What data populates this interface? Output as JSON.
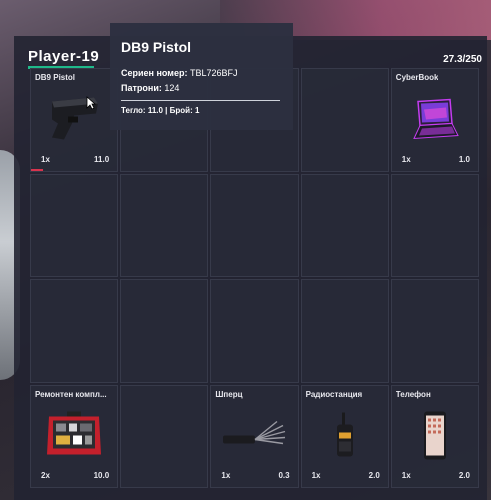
{
  "player": {
    "name": "Player-19",
    "weight": "27.3/250"
  },
  "tooltip": {
    "title": "DB9 Pistol",
    "serial_label": "Сериен номер:",
    "serial_value": "TBL726BFJ",
    "ammo_label": "Патрони:",
    "ammo_value": "124",
    "footer": "Тегло: 11.0 | Брой: 1"
  },
  "slots": [
    {
      "name": "DB9 Pistol",
      "qty": "1x",
      "weight": "11.0",
      "icon": "pistol-icon"
    },
    {
      "name": "",
      "qty": "",
      "weight": ""
    },
    {
      "name": "",
      "qty": "",
      "weight": ""
    },
    {
      "name": "",
      "qty": "",
      "weight": ""
    },
    {
      "name": "CyberBook",
      "qty": "1x",
      "weight": "1.0",
      "icon": "laptop-icon"
    },
    {
      "name": "",
      "qty": "",
      "weight": ""
    },
    {
      "name": "",
      "qty": "",
      "weight": ""
    },
    {
      "name": "",
      "qty": "",
      "weight": ""
    },
    {
      "name": "",
      "qty": "",
      "weight": ""
    },
    {
      "name": "",
      "qty": "",
      "weight": ""
    },
    {
      "name": "",
      "qty": "",
      "weight": ""
    },
    {
      "name": "",
      "qty": "",
      "weight": ""
    },
    {
      "name": "",
      "qty": "",
      "weight": ""
    },
    {
      "name": "",
      "qty": "",
      "weight": ""
    },
    {
      "name": "",
      "qty": "",
      "weight": ""
    },
    {
      "name": "Ремонтен компл...",
      "qty": "2x",
      "weight": "10.0",
      "icon": "repair-kit-icon"
    },
    {
      "name": "",
      "qty": "",
      "weight": ""
    },
    {
      "name": "Шперц",
      "qty": "1x",
      "weight": "0.3",
      "icon": "lockpick-icon"
    },
    {
      "name": "Радиостанция",
      "qty": "1x",
      "weight": "2.0",
      "icon": "radio-icon"
    },
    {
      "name": "Телефон",
      "qty": "1x",
      "weight": "2.0",
      "icon": "phone-icon"
    }
  ],
  "colors": {
    "accent": "#1fb98a",
    "durability": "#d8344e",
    "panel": "#22243a"
  }
}
